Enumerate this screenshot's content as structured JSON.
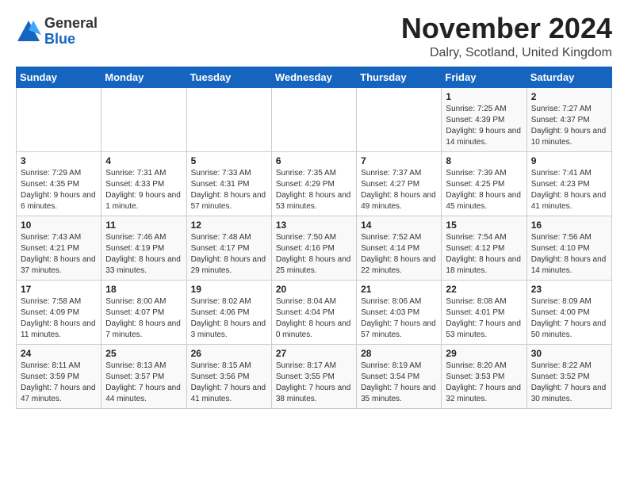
{
  "logo": {
    "general": "General",
    "blue": "Blue"
  },
  "title": "November 2024",
  "location": "Dalry, Scotland, United Kingdom",
  "days_of_week": [
    "Sunday",
    "Monday",
    "Tuesday",
    "Wednesday",
    "Thursday",
    "Friday",
    "Saturday"
  ],
  "weeks": [
    [
      {
        "day": "",
        "info": ""
      },
      {
        "day": "",
        "info": ""
      },
      {
        "day": "",
        "info": ""
      },
      {
        "day": "",
        "info": ""
      },
      {
        "day": "",
        "info": ""
      },
      {
        "day": "1",
        "info": "Sunrise: 7:25 AM\nSunset: 4:39 PM\nDaylight: 9 hours and 14 minutes."
      },
      {
        "day": "2",
        "info": "Sunrise: 7:27 AM\nSunset: 4:37 PM\nDaylight: 9 hours and 10 minutes."
      }
    ],
    [
      {
        "day": "3",
        "info": "Sunrise: 7:29 AM\nSunset: 4:35 PM\nDaylight: 9 hours and 6 minutes."
      },
      {
        "day": "4",
        "info": "Sunrise: 7:31 AM\nSunset: 4:33 PM\nDaylight: 9 hours and 1 minute."
      },
      {
        "day": "5",
        "info": "Sunrise: 7:33 AM\nSunset: 4:31 PM\nDaylight: 8 hours and 57 minutes."
      },
      {
        "day": "6",
        "info": "Sunrise: 7:35 AM\nSunset: 4:29 PM\nDaylight: 8 hours and 53 minutes."
      },
      {
        "day": "7",
        "info": "Sunrise: 7:37 AM\nSunset: 4:27 PM\nDaylight: 8 hours and 49 minutes."
      },
      {
        "day": "8",
        "info": "Sunrise: 7:39 AM\nSunset: 4:25 PM\nDaylight: 8 hours and 45 minutes."
      },
      {
        "day": "9",
        "info": "Sunrise: 7:41 AM\nSunset: 4:23 PM\nDaylight: 8 hours and 41 minutes."
      }
    ],
    [
      {
        "day": "10",
        "info": "Sunrise: 7:43 AM\nSunset: 4:21 PM\nDaylight: 8 hours and 37 minutes."
      },
      {
        "day": "11",
        "info": "Sunrise: 7:46 AM\nSunset: 4:19 PM\nDaylight: 8 hours and 33 minutes."
      },
      {
        "day": "12",
        "info": "Sunrise: 7:48 AM\nSunset: 4:17 PM\nDaylight: 8 hours and 29 minutes."
      },
      {
        "day": "13",
        "info": "Sunrise: 7:50 AM\nSunset: 4:16 PM\nDaylight: 8 hours and 25 minutes."
      },
      {
        "day": "14",
        "info": "Sunrise: 7:52 AM\nSunset: 4:14 PM\nDaylight: 8 hours and 22 minutes."
      },
      {
        "day": "15",
        "info": "Sunrise: 7:54 AM\nSunset: 4:12 PM\nDaylight: 8 hours and 18 minutes."
      },
      {
        "day": "16",
        "info": "Sunrise: 7:56 AM\nSunset: 4:10 PM\nDaylight: 8 hours and 14 minutes."
      }
    ],
    [
      {
        "day": "17",
        "info": "Sunrise: 7:58 AM\nSunset: 4:09 PM\nDaylight: 8 hours and 11 minutes."
      },
      {
        "day": "18",
        "info": "Sunrise: 8:00 AM\nSunset: 4:07 PM\nDaylight: 8 hours and 7 minutes."
      },
      {
        "day": "19",
        "info": "Sunrise: 8:02 AM\nSunset: 4:06 PM\nDaylight: 8 hours and 3 minutes."
      },
      {
        "day": "20",
        "info": "Sunrise: 8:04 AM\nSunset: 4:04 PM\nDaylight: 8 hours and 0 minutes."
      },
      {
        "day": "21",
        "info": "Sunrise: 8:06 AM\nSunset: 4:03 PM\nDaylight: 7 hours and 57 minutes."
      },
      {
        "day": "22",
        "info": "Sunrise: 8:08 AM\nSunset: 4:01 PM\nDaylight: 7 hours and 53 minutes."
      },
      {
        "day": "23",
        "info": "Sunrise: 8:09 AM\nSunset: 4:00 PM\nDaylight: 7 hours and 50 minutes."
      }
    ],
    [
      {
        "day": "24",
        "info": "Sunrise: 8:11 AM\nSunset: 3:59 PM\nDaylight: 7 hours and 47 minutes."
      },
      {
        "day": "25",
        "info": "Sunrise: 8:13 AM\nSunset: 3:57 PM\nDaylight: 7 hours and 44 minutes."
      },
      {
        "day": "26",
        "info": "Sunrise: 8:15 AM\nSunset: 3:56 PM\nDaylight: 7 hours and 41 minutes."
      },
      {
        "day": "27",
        "info": "Sunrise: 8:17 AM\nSunset: 3:55 PM\nDaylight: 7 hours and 38 minutes."
      },
      {
        "day": "28",
        "info": "Sunrise: 8:19 AM\nSunset: 3:54 PM\nDaylight: 7 hours and 35 minutes."
      },
      {
        "day": "29",
        "info": "Sunrise: 8:20 AM\nSunset: 3:53 PM\nDaylight: 7 hours and 32 minutes."
      },
      {
        "day": "30",
        "info": "Sunrise: 8:22 AM\nSunset: 3:52 PM\nDaylight: 7 hours and 30 minutes."
      }
    ]
  ]
}
